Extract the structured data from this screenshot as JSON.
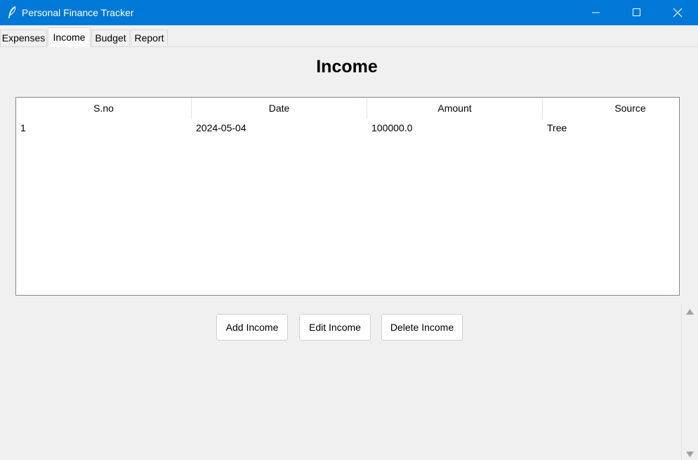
{
  "window": {
    "title": "Personal Finance Tracker",
    "icon": "feather-icon",
    "controls": [
      "minimize-icon",
      "maximize-icon",
      "close-icon"
    ],
    "accent_color": "#0078d7"
  },
  "tabs": [
    {
      "label": "Expenses",
      "active": false
    },
    {
      "label": "Income",
      "active": true
    },
    {
      "label": "Budget",
      "active": false
    },
    {
      "label": "Report",
      "active": false
    }
  ],
  "page": {
    "title": "Income"
  },
  "table": {
    "columns": [
      "S.no",
      "Date",
      "Amount",
      "Source"
    ],
    "rows": [
      [
        "1",
        "2024-05-04",
        "100000.0",
        "Tree"
      ]
    ]
  },
  "buttons": {
    "add": "Add Income",
    "edit": "Edit Income",
    "delete": "Delete Income"
  },
  "scrollbar": {
    "icons": [
      "scroll-up-arrow-icon",
      "scroll-down-arrow-icon"
    ]
  }
}
